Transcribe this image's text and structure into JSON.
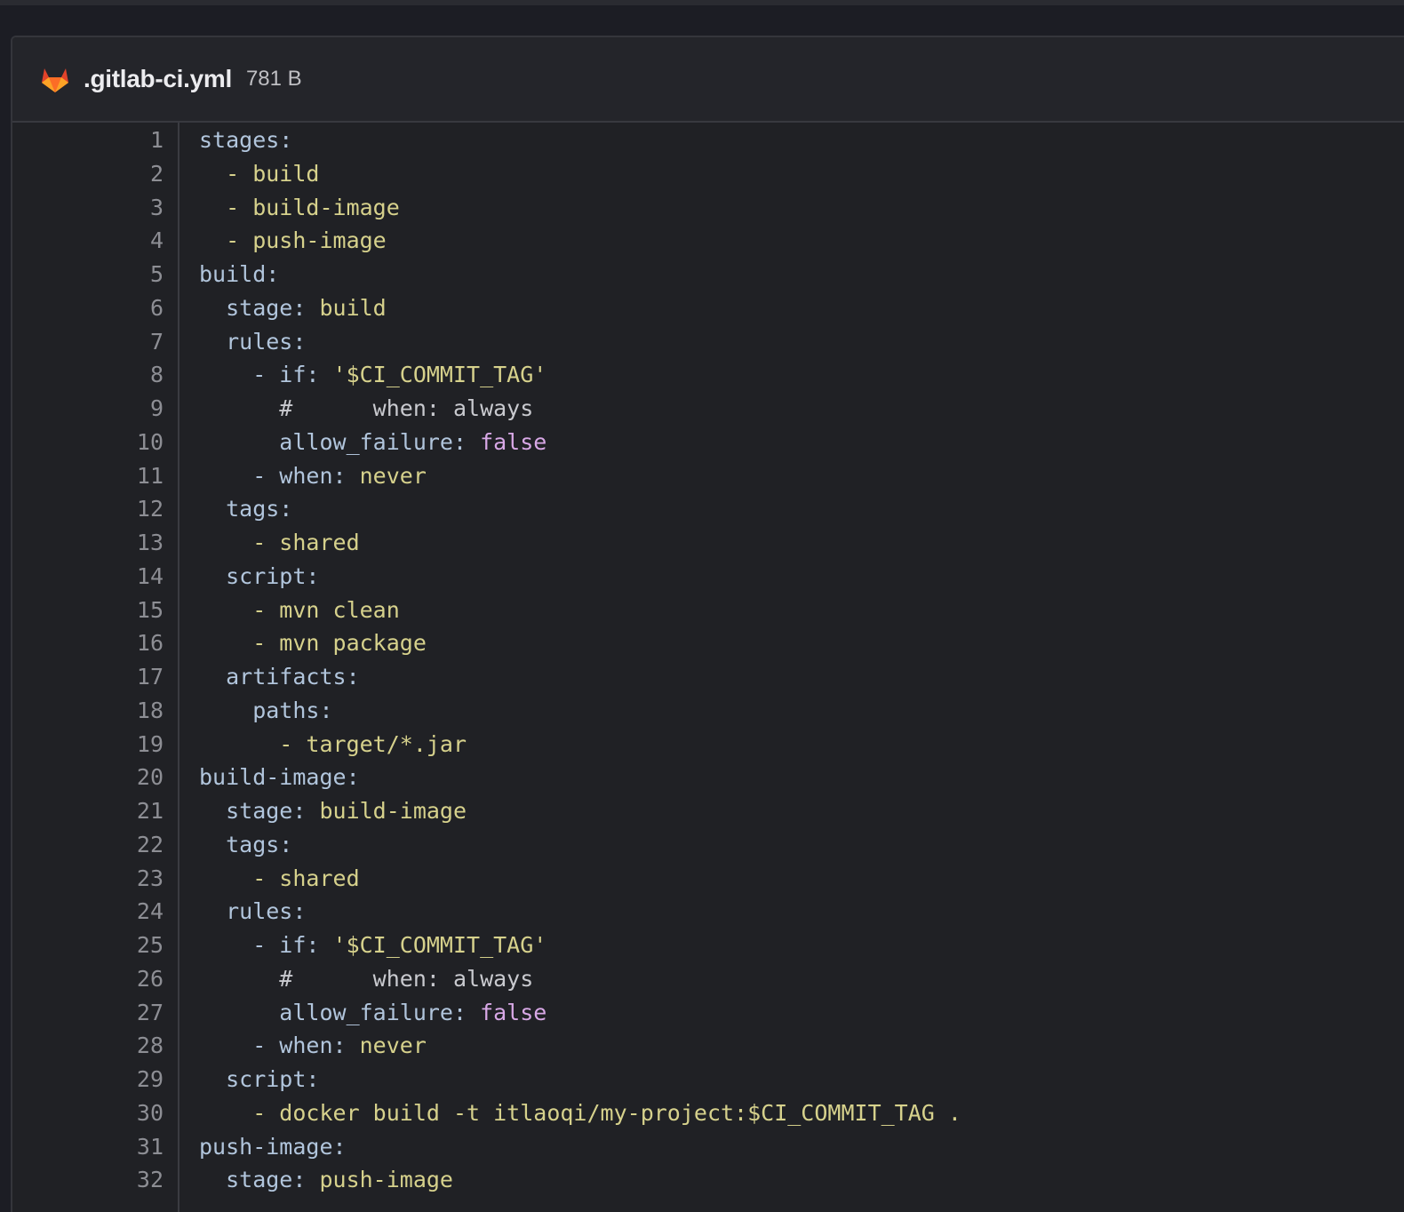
{
  "file": {
    "name": ".gitlab-ci.yml",
    "size": "781 B",
    "icon": "gitlab-fox-icon"
  },
  "colors": {
    "key": "#b1c5dc",
    "value": "#d6d18c",
    "boolean": "#d8a8e6",
    "comment": "#c9cacf",
    "line_number": "#8d8e94"
  },
  "lines": [
    {
      "n": "1",
      "tokens": [
        [
          "key",
          "stages:"
        ]
      ]
    },
    {
      "n": "2",
      "tokens": [
        [
          "val",
          "  - build"
        ]
      ]
    },
    {
      "n": "3",
      "tokens": [
        [
          "val",
          "  - build-image"
        ]
      ]
    },
    {
      "n": "4",
      "tokens": [
        [
          "val",
          "  - push-image"
        ]
      ]
    },
    {
      "n": "5",
      "tokens": [
        [
          "key",
          "build:"
        ]
      ]
    },
    {
      "n": "6",
      "tokens": [
        [
          "key",
          "  stage: "
        ],
        [
          "val",
          "build"
        ]
      ]
    },
    {
      "n": "7",
      "tokens": [
        [
          "key",
          "  rules:"
        ]
      ]
    },
    {
      "n": "8",
      "tokens": [
        [
          "key",
          "    - if: "
        ],
        [
          "val",
          "'$CI_COMMIT_TAG'"
        ]
      ]
    },
    {
      "n": "9",
      "tokens": [
        [
          "comment",
          "      #      when: always"
        ]
      ]
    },
    {
      "n": "10",
      "tokens": [
        [
          "key",
          "      allow_failure: "
        ],
        [
          "bool",
          "false"
        ]
      ]
    },
    {
      "n": "11",
      "tokens": [
        [
          "key",
          "    - when: "
        ],
        [
          "val",
          "never"
        ]
      ]
    },
    {
      "n": "12",
      "tokens": [
        [
          "key",
          "  tags:"
        ]
      ]
    },
    {
      "n": "13",
      "tokens": [
        [
          "val",
          "    - shared"
        ]
      ]
    },
    {
      "n": "14",
      "tokens": [
        [
          "key",
          "  script:"
        ]
      ]
    },
    {
      "n": "15",
      "tokens": [
        [
          "val",
          "    - mvn clean"
        ]
      ]
    },
    {
      "n": "16",
      "tokens": [
        [
          "val",
          "    - mvn package"
        ]
      ]
    },
    {
      "n": "17",
      "tokens": [
        [
          "key",
          "  artifacts:"
        ]
      ]
    },
    {
      "n": "18",
      "tokens": [
        [
          "key",
          "    paths:"
        ]
      ]
    },
    {
      "n": "19",
      "tokens": [
        [
          "val",
          "      - target/*.jar"
        ]
      ]
    },
    {
      "n": "20",
      "tokens": [
        [
          "key",
          "build-image:"
        ]
      ]
    },
    {
      "n": "21",
      "tokens": [
        [
          "key",
          "  stage: "
        ],
        [
          "val",
          "build-image"
        ]
      ]
    },
    {
      "n": "22",
      "tokens": [
        [
          "key",
          "  tags:"
        ]
      ]
    },
    {
      "n": "23",
      "tokens": [
        [
          "val",
          "    - shared"
        ]
      ]
    },
    {
      "n": "24",
      "tokens": [
        [
          "key",
          "  rules:"
        ]
      ]
    },
    {
      "n": "25",
      "tokens": [
        [
          "key",
          "    - if: "
        ],
        [
          "val",
          "'$CI_COMMIT_TAG'"
        ]
      ]
    },
    {
      "n": "26",
      "tokens": [
        [
          "comment",
          "      #      when: always"
        ]
      ]
    },
    {
      "n": "27",
      "tokens": [
        [
          "key",
          "      allow_failure: "
        ],
        [
          "bool",
          "false"
        ]
      ]
    },
    {
      "n": "28",
      "tokens": [
        [
          "key",
          "    - when: "
        ],
        [
          "val",
          "never"
        ]
      ]
    },
    {
      "n": "29",
      "tokens": [
        [
          "key",
          "  script:"
        ]
      ]
    },
    {
      "n": "30",
      "tokens": [
        [
          "val",
          "    - docker build -t itlaoqi/my-project:$CI_COMMIT_TAG ."
        ]
      ]
    },
    {
      "n": "31",
      "tokens": [
        [
          "key",
          "push-image:"
        ]
      ]
    },
    {
      "n": "32",
      "tokens": [
        [
          "key",
          "  stage: "
        ],
        [
          "val",
          "push-image"
        ]
      ]
    }
  ]
}
